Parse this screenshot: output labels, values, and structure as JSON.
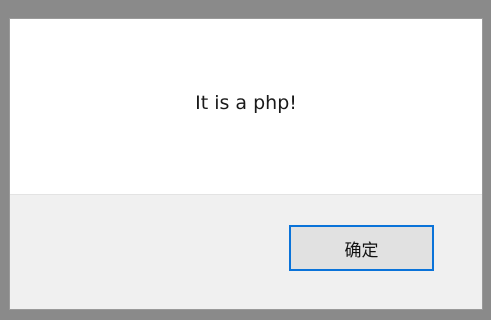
{
  "dialog": {
    "message": "It is a php!",
    "ok_label": "确定"
  },
  "colors": {
    "backdrop": "#8a8a8a",
    "dialog_bg": "#ffffff",
    "footer_bg": "#f0f0f0",
    "button_bg": "#e1e1e1",
    "button_focus_border": "#0a73d9"
  }
}
